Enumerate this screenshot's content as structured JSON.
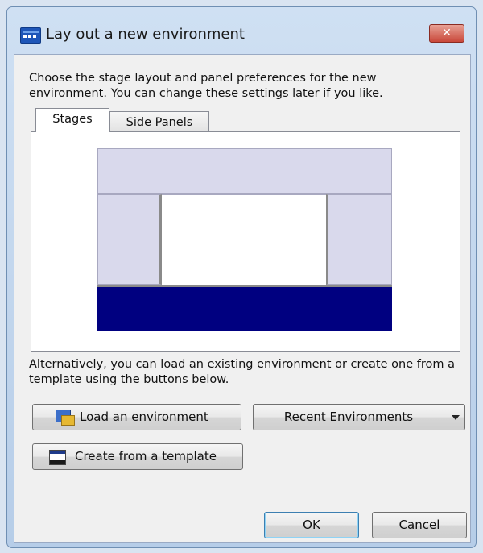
{
  "window": {
    "title": "Lay out a new environment",
    "close_glyph": "✕"
  },
  "intro_text": "Choose the stage layout and panel preferences for the new environment. You can change these settings later if you like.",
  "tabs": [
    {
      "label": "Stages",
      "selected": true
    },
    {
      "label": "Side Panels",
      "selected": false
    }
  ],
  "alt_text": "Alternatively, you can load an existing environment or create one from a template using the buttons below.",
  "buttons": {
    "load": "Load an environment",
    "recent": "Recent Environments",
    "template": "Create from a template",
    "ok": "OK",
    "cancel": "Cancel"
  },
  "icons": {
    "app": "app-window-icon",
    "load": "load-folder-icon",
    "template": "template-icon",
    "dropdown": "dropdown-arrow-icon"
  },
  "colors": {
    "stage_panel": "#d9d9ec",
    "stage_bottom": "#000080",
    "close_button": "#c9483a"
  }
}
